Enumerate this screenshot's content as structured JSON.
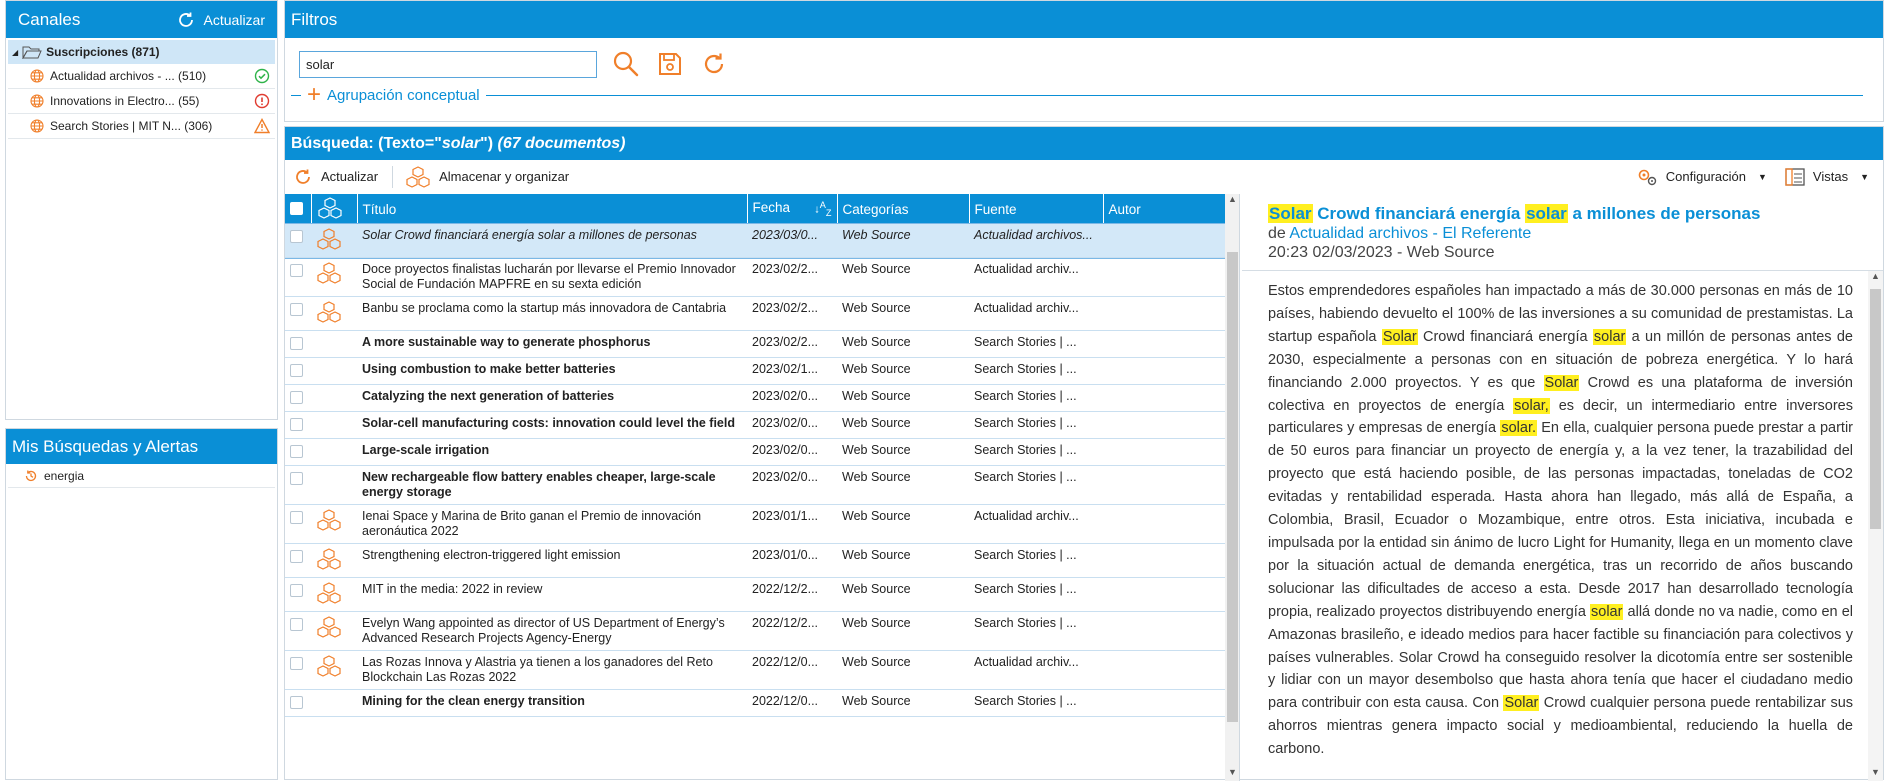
{
  "canales": {
    "title": "Canales",
    "refresh_label": "Actualizar",
    "root": {
      "label": "Suscripciones (871)"
    },
    "items": [
      {
        "label": "Actualidad archivos - ... (510)",
        "status": "ok",
        "status_color": "#2fb34a"
      },
      {
        "label": "Innovations in Electro... (55)",
        "status": "error",
        "status_color": "#e03c31"
      },
      {
        "label": "Search Stories | MIT N... (306)",
        "status": "warning",
        "status_color": "#f07f2a"
      }
    ]
  },
  "busquedas": {
    "title": "Mis Búsquedas y Alertas",
    "items": [
      {
        "label": "energia"
      }
    ]
  },
  "filtros": {
    "title": "Filtros",
    "search_value": "solar",
    "agrupacion_label": "Agrupación conceptual"
  },
  "busqueda": {
    "header_prefix": "Búsqueda: (Texto=\"",
    "header_term": "solar",
    "header_suffix": "\")",
    "header_count": "(67 documentos)",
    "toolbar": {
      "refresh_label": "Actualizar",
      "store_label": "Almacenar y organizar",
      "config_label": "Configuración",
      "views_label": "Vistas"
    },
    "columns": {
      "title": "Título",
      "date": "Fecha",
      "categories": "Categorías",
      "source": "Fuente",
      "author": "Autor"
    },
    "rows": [
      {
        "title": "Solar Crowd financiará energía solar a millones de personas",
        "date": "2023/03/0...",
        "category": "Web Source",
        "source": "Actualidad archivos...",
        "author": "",
        "icon": true,
        "bold": false,
        "selected": true
      },
      {
        "title": "Doce proyectos finalistas lucharán por llevarse el Premio Innovador Social de Fundación MAPFRE en su sexta edición",
        "date": "2023/02/2...",
        "category": "Web Source",
        "source": "Actualidad archiv...",
        "author": "",
        "icon": true,
        "bold": false
      },
      {
        "title": "Banbu se proclama como la startup más innovadora de Cantabria",
        "date": "2023/02/2...",
        "category": "Web Source",
        "source": "Actualidad archiv...",
        "author": "",
        "icon": true,
        "bold": false
      },
      {
        "title": "A more sustainable way to generate phosphorus",
        "date": "2023/02/2...",
        "category": "Web Source",
        "source": "Search Stories | ...",
        "author": "",
        "icon": false,
        "bold": true
      },
      {
        "title": "Using combustion to make better batteries",
        "date": "2023/02/1...",
        "category": "Web Source",
        "source": "Search Stories | ...",
        "author": "",
        "icon": false,
        "bold": true
      },
      {
        "title": "Catalyzing the next generation of batteries",
        "date": "2023/02/0...",
        "category": "Web Source",
        "source": "Search Stories | ...",
        "author": "",
        "icon": false,
        "bold": true
      },
      {
        "title": "Solar-cell manufacturing costs: innovation could level the field",
        "date": "2023/02/0...",
        "category": "Web Source",
        "source": "Search Stories | ...",
        "author": "",
        "icon": false,
        "bold": true
      },
      {
        "title": "Large-scale irrigation",
        "date": "2023/02/0...",
        "category": "Web Source",
        "source": "Search Stories | ...",
        "author": "",
        "icon": false,
        "bold": true
      },
      {
        "title": "New rechargeable flow battery enables cheaper, large-scale energy storage",
        "date": "2023/02/0...",
        "category": "Web Source",
        "source": "Search Stories | ...",
        "author": "",
        "icon": false,
        "bold": true
      },
      {
        "title": "Ienai Space y Marina de Brito ganan el Premio de innovación aeronáutica 2022",
        "date": "2023/01/1...",
        "category": "Web Source",
        "source": "Actualidad archiv...",
        "author": "",
        "icon": true,
        "bold": false
      },
      {
        "title": "Strengthening electron-triggered light emission",
        "date": "2023/01/0...",
        "category": "Web Source",
        "source": "Search Stories | ...",
        "author": "",
        "icon": true,
        "bold": false
      },
      {
        "title": "MIT in the media: 2022 in review",
        "date": "2022/12/2...",
        "category": "Web Source",
        "source": "Search Stories | ...",
        "author": "",
        "icon": true,
        "bold": false
      },
      {
        "title": "Evelyn Wang appointed as director of US Department of Energy’s Advanced Research Projects Agency-Energy",
        "date": "2022/12/2...",
        "category": "Web Source",
        "source": "Search Stories | ...",
        "author": "",
        "icon": true,
        "bold": false
      },
      {
        "title": "Las Rozas Innova y Alastria ya tienen a los ganadores del Reto Blockchain Las Rozas 2022",
        "date": "2022/12/0...",
        "category": "Web Source",
        "source": "Actualidad archiv...",
        "author": "",
        "icon": true,
        "bold": false
      },
      {
        "title": "Mining for the clean energy transition",
        "date": "2022/12/0...",
        "category": "Web Source",
        "source": "Search Stories | ...",
        "author": "",
        "icon": false,
        "bold": true
      }
    ]
  },
  "preview": {
    "title_segments": [
      {
        "text": "Solar",
        "hl": true
      },
      {
        "text": " Crowd financiará energía ",
        "hl": false
      },
      {
        "text": "solar",
        "hl": true
      },
      {
        "text": " a millones de personas",
        "hl": false
      }
    ],
    "source_prefix": "de ",
    "source_link": "Actualidad archivos - El Referente",
    "date_line": "20:23 02/03/2023 - Web Source",
    "body_segments": [
      {
        "text": "Estos emprendedores españoles han impactado a más de 30.000 personas en más de 10 países, habiendo devuelto el 100% de las inversiones a su comunidad de prestamistas. La startup española ",
        "hl": false
      },
      {
        "text": "Solar",
        "hl": true
      },
      {
        "text": " Crowd financiará energía ",
        "hl": false
      },
      {
        "text": "solar",
        "hl": true
      },
      {
        "text": " a un millón de personas antes de 2030, especialmente a personas con en situación de pobreza energética. Y lo hará financiando 2.000 proyectos. Y es que ",
        "hl": false
      },
      {
        "text": "Solar",
        "hl": true
      },
      {
        "text": " Crowd es una plataforma de inversión colectiva en proyectos de energía ",
        "hl": false
      },
      {
        "text": "solar,",
        "hl": true
      },
      {
        "text": " es decir, un intermediario entre inversores particulares y empresas de energía ",
        "hl": false
      },
      {
        "text": "solar.",
        "hl": true
      },
      {
        "text": " En ella, cualquier persona puede prestar a partir de 50 euros para financiar un proyecto de energía y, a la vez tener, la trazabilidad del proyecto que está haciendo posible, de las personas impactadas, toneladas de CO2 evitadas y rentabilidad esperada. Hasta ahora han llegado, más allá de España, a Colombia, Brasil, Ecuador o Mozambique, entre otros. Esta iniciativa, incubada e impulsada por la entidad sin ánimo de lucro Light for Humanity, llega en un momento clave por la situación actual de demanda energética, tras un recorrido de años buscando solucionar las dificultades de acceso a esta. Desde 2017 han desarrollado tecnología propia, realizado proyectos distribuyendo energía ",
        "hl": false
      },
      {
        "text": "solar",
        "hl": true
      },
      {
        "text": " allá donde no va nadie, como en el Amazonas brasileño, e ideado medios para hacer factible su financiación para colectivos y países vulnerables. Solar Crowd ha conseguido resolver la dicotomía entre ser sostenible y lidiar con un mayor desembolso que hasta ahora tenía que hacer el ciudadano medio para contribuir con esta causa. Con ",
        "hl": false
      },
      {
        "text": "Solar",
        "hl": true
      },
      {
        "text": " Crowd cualquier persona puede rentabilizar sus ahorros mientras genera impacto social y medioambiental, reduciendo la huella de carbono.",
        "hl": false
      }
    ]
  },
  "colors": {
    "accent": "#0a8fd6",
    "icon": "#f07f2a",
    "highlight": "#ffef20",
    "selected_row": "#d3e8f8"
  }
}
